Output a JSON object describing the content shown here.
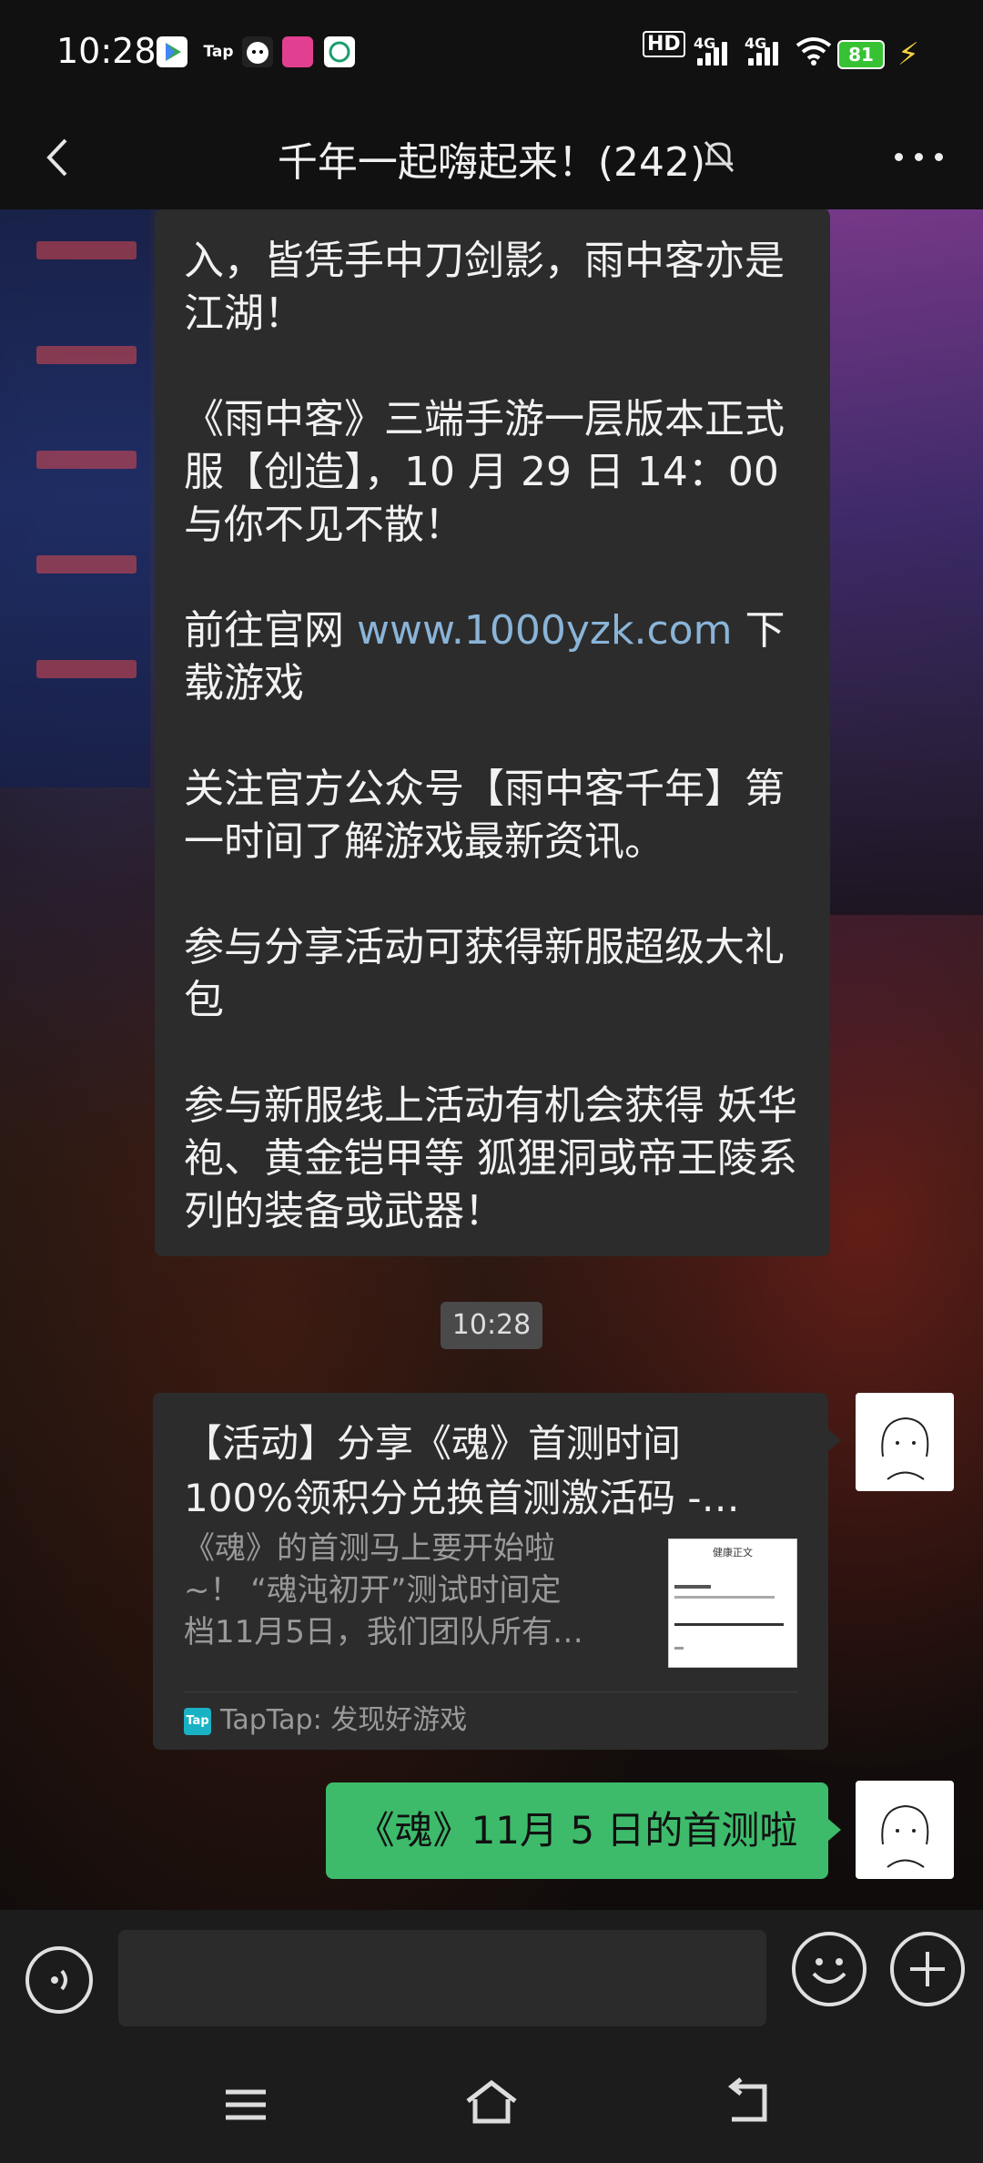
{
  "status_bar": {
    "time": "10:28",
    "apps": [
      "play-games-icon",
      "tap-icon",
      "chicken-icon",
      "lemon-icon",
      "mobile-icon"
    ],
    "tap_label": "Tap",
    "hd_label": "HD",
    "net1": "4G",
    "net2": "4G",
    "battery": "81"
  },
  "header": {
    "title": "千年一起嗨起来！(242)"
  },
  "messages": [
    {
      "type": "text",
      "paragraphs": [
        {
          "prefix": "入，皆凭手中刀剑影，雨中客亦是江湖！",
          "link": "",
          "suffix": ""
        },
        {
          "prefix": "《雨中客》三端手游一层版本正式服【创造】，10 月 29 日 14：00 与你不见不散！",
          "link": "",
          "suffix": ""
        },
        {
          "prefix": "前往官网 ",
          "link": "www.1000yzk.com",
          "suffix": " 下载游戏"
        },
        {
          "prefix": "关注官方公众号【雨中客千年】第一时间了解游戏最新资讯。",
          "link": "",
          "suffix": ""
        },
        {
          "prefix": "参与分享活动可获得新服超级大礼包",
          "link": "",
          "suffix": ""
        },
        {
          "prefix": "参与新服线上活动有机会获得 妖华袍、黄金铠甲等 狐狸洞或帝王陵系列的装备或武器！",
          "link": "",
          "suffix": ""
        }
      ]
    },
    {
      "type": "time",
      "label": "10:28"
    },
    {
      "type": "link_card",
      "title_line1": "【活动】分享《魂》首测时间",
      "title_line2": "100%领积分兑换首测激活码 -…",
      "desc_line1": "《魂》的首测马上要开始啦",
      "desc_line2": "~！ “魂沌初开”测试时间定",
      "desc_line3": "档11月5日，我们团队所有…",
      "thumb_title": "健康正文",
      "source_icon": "Tap",
      "source": "TapTap: 发现好游戏"
    },
    {
      "type": "text_self",
      "text": "《魂》11月 5 日的首测啦"
    }
  ],
  "colors": {
    "bubble_received": "#2c2c2c",
    "bubble_sent": "#3dbb6b",
    "link": "#8ab4d8",
    "battery": "#36c233"
  }
}
